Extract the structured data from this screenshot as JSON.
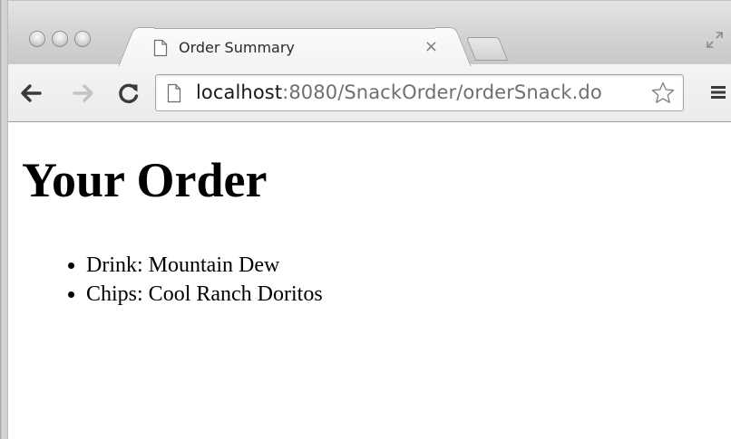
{
  "browser": {
    "tab": {
      "title": "Order Summary",
      "close_glyph": "×"
    },
    "toolbar": {
      "url_host": "localhost",
      "url_rest": ":8080/SnackOrder/orderSnack.do"
    },
    "icons": {
      "tab_icon": "page-icon",
      "back": "arrow-left-icon",
      "forward": "arrow-right-icon",
      "reload": "reload-icon",
      "omnibox_icon": "page-icon",
      "bookmark": "star-icon",
      "menu": "hamburger-menu-icon",
      "window": "fullscreen-icon"
    }
  },
  "page": {
    "heading": "Your Order",
    "items": [
      "Drink: Mountain Dew",
      "Chips: Cool Ranch Doritos"
    ]
  }
}
